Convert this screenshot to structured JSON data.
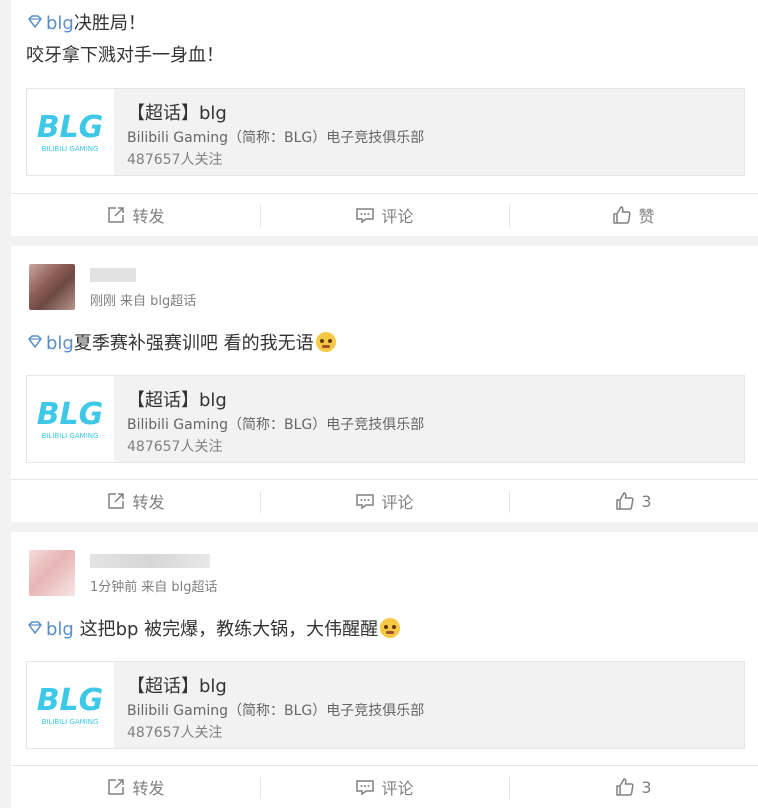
{
  "cards": [
    {
      "lines": [
        "决胜局！",
        "咬牙拿下溅对手一身血！"
      ],
      "tag": "blg",
      "topic": {
        "title": "【超话】blg",
        "desc": "Bilibili Gaming（简称：BLG）电子竞技俱乐部",
        "followers": "487657人关注",
        "logo_text": "BLG",
        "logo_sub": "BILIBILI GAMING"
      },
      "actions": {
        "repost": "转发",
        "comment": "评论",
        "like": "赞"
      }
    },
    {
      "meta_time": "刚刚",
      "meta_source": "来自 blg超话",
      "tag": "blg",
      "text": "夏季赛补强赛训吧 看的我无语",
      "topic": {
        "title": "【超话】blg",
        "desc": "Bilibili Gaming（简称：BLG）电子竞技俱乐部",
        "followers": "487657人关注",
        "logo_text": "BLG",
        "logo_sub": "BILIBILI GAMING"
      },
      "actions": {
        "repost": "转发",
        "comment": "评论",
        "like": "3"
      }
    },
    {
      "meta_time": "1分钟前",
      "meta_source": "来自 blg超话",
      "tag": "blg",
      "text": " 这把bp 被完爆，教练大锅，大伟醒醒",
      "topic": {
        "title": "【超话】blg",
        "desc": "Bilibili Gaming（简称：BLG）电子竞技俱乐部",
        "followers": "487657人关注",
        "logo_text": "BLG",
        "logo_sub": "BILIBILI GAMING"
      },
      "actions": {
        "repost": "转发",
        "comment": "评论",
        "like": "3"
      }
    }
  ],
  "colors": {
    "tag": "#5a8fc6",
    "logo": "#3cc8e6",
    "text": "#333333",
    "muted": "#808080"
  },
  "icons": {
    "tag": "diamond-icon",
    "repost": "share-icon",
    "comment": "comment-icon",
    "like": "thumbs-up-icon",
    "emoji": "crying-emoji-icon"
  }
}
